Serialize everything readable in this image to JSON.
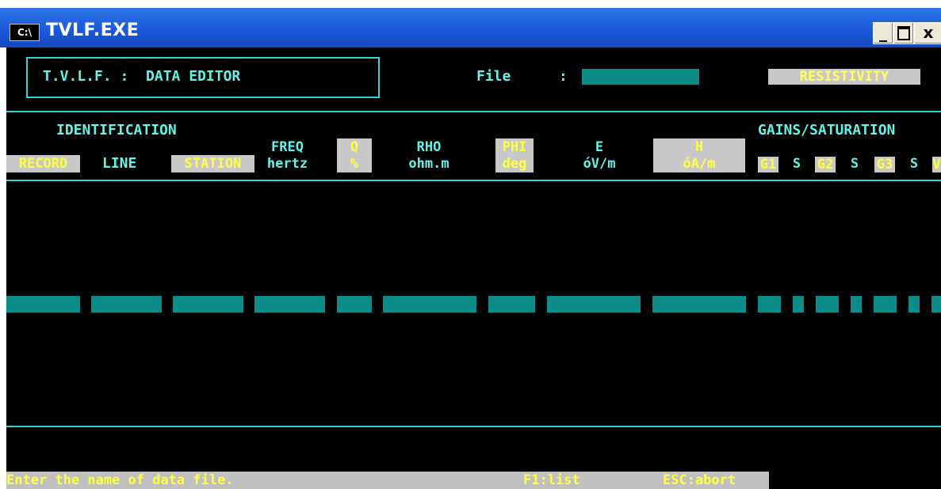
{
  "window": {
    "title": "TVLF.EXE",
    "icon_label": "C:\\",
    "minimize_label": "_",
    "close_label": "x"
  },
  "header": {
    "app_title": "T.V.L.F. :  DATA EDITOR",
    "file_label": "File",
    "file_sep": ":",
    "file_value": "",
    "mode_label": "RESISTIVITY"
  },
  "columns": {
    "identification_heading": "IDENTIFICATION",
    "gains_heading": "GAINS/SATURATION",
    "record": "RECORD",
    "line": "LINE",
    "station": "STATION",
    "freq_top": "FREQ",
    "freq_unit": "hertz",
    "q_top": "Q",
    "q_unit": "%",
    "rho_top": "RHO",
    "rho_unit": "ohm.m",
    "phi_top": "PHI",
    "phi_unit": "deg",
    "e_top": "E",
    "e_unit": "óV/m",
    "h_top": "H",
    "h_unit": "óA/m",
    "g1": "G1",
    "s1": "S",
    "g2": "G2",
    "s2": "S",
    "g3": "G3",
    "s3": "S",
    "g4": "V"
  },
  "status_bar": {
    "prompt": "Enter the name of data file.",
    "f1": "F1:list",
    "esc": "ESC:abort"
  },
  "colors": {
    "background": "#000000",
    "accent_cyan": "#5ff5e8",
    "field_teal": "#0b8c88",
    "highlight_yellow": "#ffff40",
    "highlight_bg": "#c8c8c8"
  }
}
